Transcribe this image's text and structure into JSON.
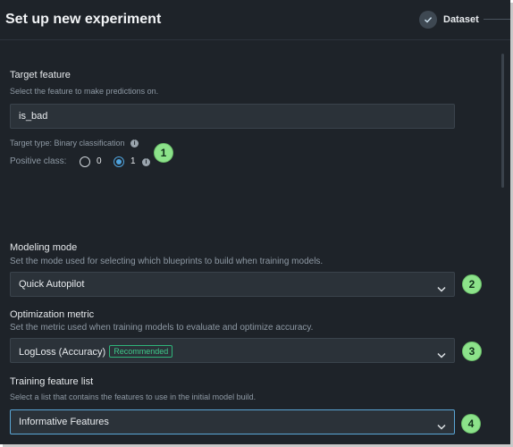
{
  "header": {
    "title": "Set up new experiment",
    "steps": [
      {
        "label": "Dataset",
        "icon": "check-icon"
      }
    ]
  },
  "target": {
    "title": "Target feature",
    "description": "Select the feature to make predictions on.",
    "value": "is_bad",
    "type_text": "Target type: Binary classification",
    "positive_class_label": "Positive class:",
    "options": [
      "0",
      "1"
    ],
    "selected_option": "1"
  },
  "modeling": {
    "title": "Modeling mode",
    "description": "Set the mode used for selecting which blueprints to build when training models.",
    "value": "Quick Autopilot"
  },
  "metric": {
    "title": "Optimization metric",
    "description": "Set the metric used when training models to evaluate and optimize accuracy.",
    "value": "LogLoss (Accuracy)",
    "badge": "Recommended"
  },
  "featurelist": {
    "title": "Training feature list",
    "description": "Select a list that contains the features to use in the initial model build.",
    "value": "Informative Features"
  },
  "callouts": [
    "1",
    "2",
    "3",
    "4"
  ],
  "colors": {
    "background": "#1e2329",
    "field": "#2b3239",
    "accent": "#4fa3dd",
    "callout": "#8ce28a",
    "recommended": "#3ec98a"
  }
}
